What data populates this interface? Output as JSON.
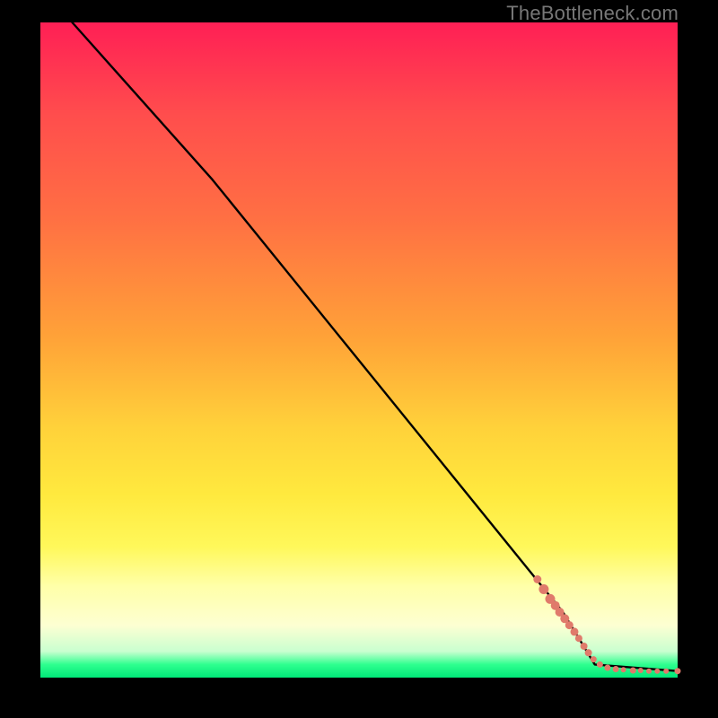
{
  "watermark": "TheBottleneck.com",
  "colors": {
    "line": "#000000",
    "dot": "#e07a6b",
    "background": "#000000"
  },
  "chart_data": {
    "type": "line",
    "title": "",
    "xlabel": "",
    "ylabel": "",
    "xlim": [
      0,
      100
    ],
    "ylim": [
      0,
      100
    ],
    "grid": false,
    "legend": false,
    "series": [
      {
        "name": "curve",
        "style": "line",
        "color": "#000000",
        "x": [
          5,
          27,
          82,
          87,
          100
        ],
        "y": [
          100,
          76,
          10,
          2,
          1
        ]
      },
      {
        "name": "data-points",
        "style": "scatter",
        "color": "#e07a6b",
        "points": [
          {
            "x": 78,
            "y": 15,
            "r": 4.5
          },
          {
            "x": 79,
            "y": 13.5,
            "r": 5.5
          },
          {
            "x": 80,
            "y": 12,
            "r": 5.5
          },
          {
            "x": 80.8,
            "y": 11,
            "r": 5
          },
          {
            "x": 81.5,
            "y": 10,
            "r": 5
          },
          {
            "x": 82.3,
            "y": 9,
            "r": 5
          },
          {
            "x": 83,
            "y": 8,
            "r": 4.5
          },
          {
            "x": 83.8,
            "y": 7,
            "r": 4.5
          },
          {
            "x": 84.5,
            "y": 6,
            "r": 4
          },
          {
            "x": 85.3,
            "y": 4.8,
            "r": 4
          },
          {
            "x": 86,
            "y": 3.8,
            "r": 4
          },
          {
            "x": 86.8,
            "y": 2.8,
            "r": 3.5
          },
          {
            "x": 87.8,
            "y": 2,
            "r": 3.5
          },
          {
            "x": 89,
            "y": 1.5,
            "r": 3.5
          },
          {
            "x": 90.3,
            "y": 1.3,
            "r": 3.5
          },
          {
            "x": 91.5,
            "y": 1.2,
            "r": 3
          },
          {
            "x": 93,
            "y": 1.1,
            "r": 3.5
          },
          {
            "x": 94.2,
            "y": 1.1,
            "r": 3
          },
          {
            "x": 95.5,
            "y": 1.0,
            "r": 3
          },
          {
            "x": 96.8,
            "y": 1.0,
            "r": 3
          },
          {
            "x": 98.2,
            "y": 1.0,
            "r": 3
          },
          {
            "x": 100,
            "y": 1.0,
            "r": 3.5
          }
        ]
      }
    ]
  }
}
